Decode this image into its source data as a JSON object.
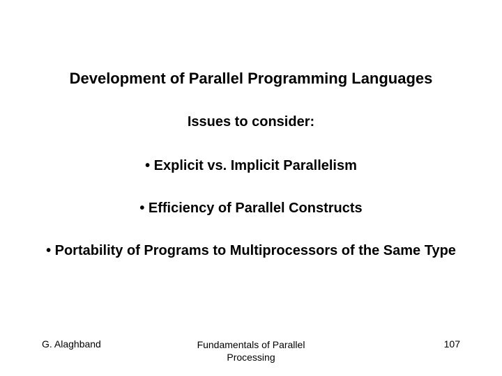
{
  "title": "Development of Parallel Programming Languages",
  "subtitle": "Issues to consider:",
  "bullets": [
    "• Explicit vs. Implicit Parallelism",
    "• Efficiency of Parallel Constructs",
    "• Portability of Programs to Multiprocessors of the Same Type"
  ],
  "footer": {
    "author": "G. Alaghband",
    "center_line1": "Fundamentals of Parallel",
    "center_line2": "Processing",
    "page": "107"
  }
}
